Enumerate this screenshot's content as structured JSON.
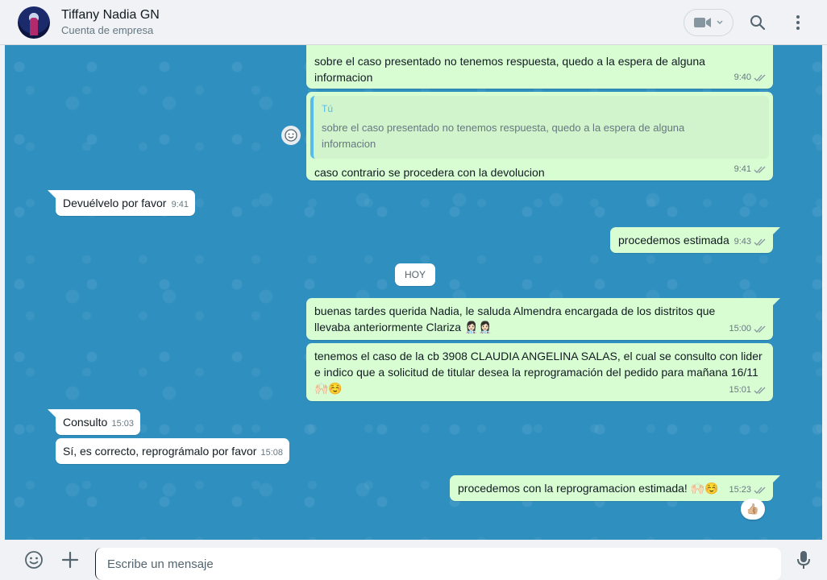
{
  "header": {
    "contact_name": "Tiffany Nadia GN",
    "contact_subtitle": "Cuenta de empresa"
  },
  "messages": [
    {
      "direction": "out",
      "text": "sobre el caso presentado no tenemos respuesta, quedo a la espera de alguna informacion",
      "time": "9:40"
    },
    {
      "direction": "out",
      "quote_author": "Tú",
      "quote_text": "sobre el caso presentado no tenemos respuesta, quedo a la espera de alguna informacion",
      "text": "caso contrario se procedera con la devolucion",
      "time": "9:41"
    },
    {
      "direction": "in",
      "text": "Devuélvelo por favor",
      "time": "9:41"
    },
    {
      "direction": "out",
      "text": "procedemos estimada",
      "time": "9:43"
    },
    {
      "direction": "out",
      "text": "buenas tardes querida Nadia, le saluda Almendra encargada de los distritos que llevaba anteriormente Clariza 👩🏻‍⚕️👩🏻‍⚕️",
      "time": "15:00"
    },
    {
      "direction": "out",
      "text": "tenemos el caso de la cb 3908 CLAUDIA ANGELINA SALAS, el cual se consulto con lider e indico que a solicitud de titular desea la reprogramación del pedido para mañana 16/11 🙌🏻☺️",
      "time": "15:01"
    },
    {
      "direction": "in",
      "text": "Consulto",
      "time": "15:03"
    },
    {
      "direction": "in",
      "text": "Sí, es correcto, reprográmalo por favor",
      "time": "15:08"
    },
    {
      "direction": "out",
      "text": "procedemos con la reprogramacion estimada! 🙌🏻☺️",
      "time": "15:23",
      "reaction": "👍🏼"
    }
  ],
  "date_divider": "HOY",
  "composer": {
    "placeholder": "Escribe un mensaje"
  },
  "colors": {
    "header_bg": "#f0f2f5",
    "chat_bg": "#2f8fbf",
    "outgoing_bubble": "#d9fdd3",
    "incoming_bubble": "#ffffff",
    "read_ticks": "#8696a0",
    "quote_accent": "#53bdeb"
  },
  "icons": {
    "video": "video-call-icon",
    "search": "search-icon",
    "menu": "kebab-menu-icon",
    "emoji": "emoji-icon",
    "attach": "plus-icon",
    "mic": "microphone-icon",
    "react": "emoji-react-icon"
  }
}
